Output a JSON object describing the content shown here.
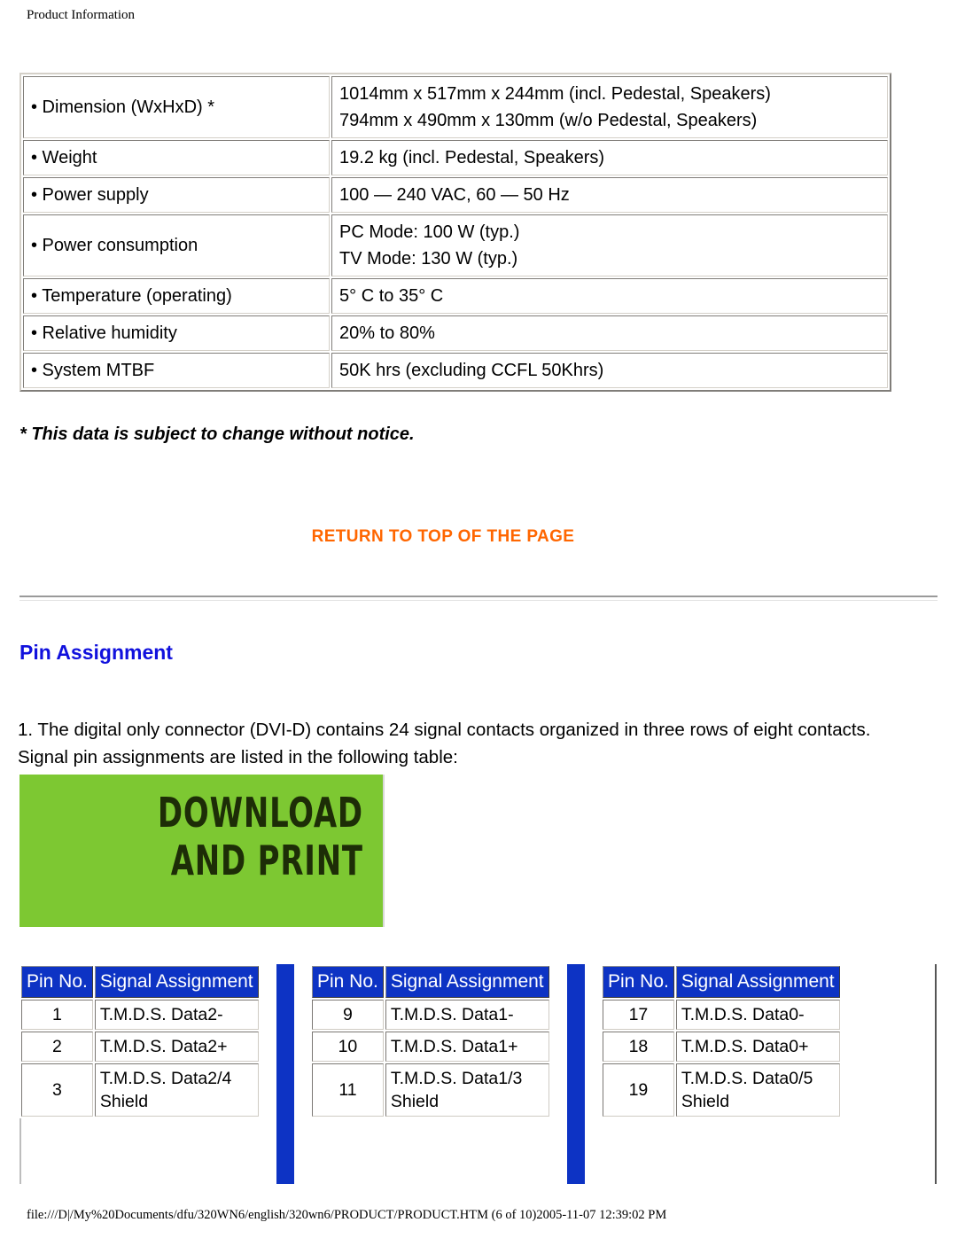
{
  "page": {
    "header": "Product Information",
    "footer": "file:///D|/My%20Documents/dfu/320WN6/english/320wn6/PRODUCT/PRODUCT.HTM (6 of 10)2005-11-07 12:39:02 PM"
  },
  "colors": {
    "link_orange": "#ff6600",
    "heading_blue": "#1111dd",
    "table_header_blue": "#0d33c4",
    "banner_green": "#7dc832"
  },
  "spec_table": {
    "rows": [
      {
        "label": "• Dimension (WxHxD) *",
        "values": [
          "1014mm x 517mm x 244mm (incl. Pedestal, Speakers)",
          "794mm x 490mm x 130mm (w/o Pedestal, Speakers)"
        ]
      },
      {
        "label": "• Weight",
        "values": [
          "19.2 kg (incl. Pedestal, Speakers)"
        ]
      },
      {
        "label": "• Power supply",
        "values": [
          "100 — 240 VAC, 60 — 50 Hz"
        ]
      },
      {
        "label": "• Power consumption",
        "values": [
          "PC Mode: 100 W (typ.)",
          "TV Mode: 130 W (typ.)"
        ]
      },
      {
        "label": "• Temperature (operating)",
        "values": [
          "5° C to 35° C"
        ]
      },
      {
        "label": "• Relative humidity",
        "values": [
          "20% to 80%"
        ]
      },
      {
        "label": "• System MTBF",
        "values": [
          "50K hrs (excluding CCFL 50Khrs)"
        ]
      }
    ]
  },
  "note": "* This data is subject to change without notice.",
  "return_to_top": "RETURN TO TOP OF THE PAGE",
  "section": {
    "heading": "Pin Assignment",
    "paragraph": "1. The digital only connector (DVI-D) contains 24 signal contacts organized in three rows of eight contacts. Signal pin assignments are listed in the following table:"
  },
  "download_banner": {
    "line1": "DOWNLOAD",
    "line2": "AND PRINT"
  },
  "pin_tables": [
    {
      "headers": {
        "pin_no": "Pin No.",
        "signal": "Signal Assignment"
      },
      "rows": [
        {
          "pin": "1",
          "signal": [
            "T.M.D.S. Data2-"
          ]
        },
        {
          "pin": "2",
          "signal": [
            "T.M.D.S. Data2+"
          ]
        },
        {
          "pin": "3",
          "signal": [
            "T.M.D.S. Data2/4",
            "Shield"
          ]
        }
      ]
    },
    {
      "headers": {
        "pin_no": "Pin No.",
        "signal": "Signal Assignment"
      },
      "rows": [
        {
          "pin": "9",
          "signal": [
            "T.M.D.S. Data1-"
          ]
        },
        {
          "pin": "10",
          "signal": [
            "T.M.D.S. Data1+"
          ]
        },
        {
          "pin": "11",
          "signal": [
            "T.M.D.S. Data1/3",
            "Shield"
          ]
        }
      ]
    },
    {
      "headers": {
        "pin_no": "Pin No.",
        "signal": "Signal Assignment"
      },
      "rows": [
        {
          "pin": "17",
          "signal": [
            "T.M.D.S. Data0-"
          ]
        },
        {
          "pin": "18",
          "signal": [
            "T.M.D.S. Data0+"
          ]
        },
        {
          "pin": "19",
          "signal": [
            "T.M.D.S. Data0/5",
            "Shield"
          ]
        }
      ]
    }
  ]
}
